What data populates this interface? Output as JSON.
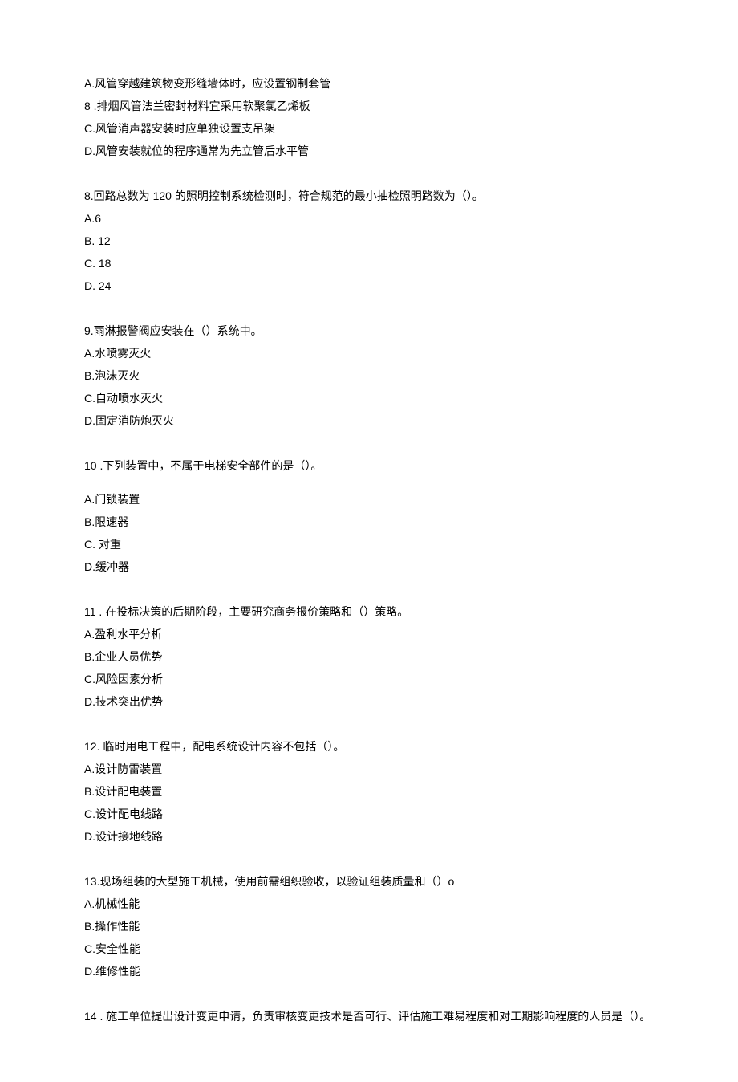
{
  "q7": {
    "optA": "A.风管穿越建筑物变形缝墙体时，应设置钢制套管",
    "optB_prefix": "8",
    "optB_text": " .排烟风管法兰密封材料宜采用软聚氯乙烯板",
    "optC": "C.风管消声器安装时应单独设置支吊架",
    "optD": "D.风管安装就位的程序通常为先立管后水平管"
  },
  "q8": {
    "stem": "8.回路总数为 120 的照明控制系统检测时，符合规范的最小抽检照明路数为（）。",
    "optA": "A.6",
    "optB": "B.   12",
    "optC": "C.   18",
    "optD": "D.   24"
  },
  "q9": {
    "stem": "9.雨淋报警阀应安装在（）系统中。",
    "optA": "A.水喷雾灭火",
    "optB": "B.泡沫灭火",
    "optC": "C.自动喷水灭火",
    "optD": "D.固定消防炮灭火"
  },
  "q10": {
    "stem_prefix": "10",
    "stem_text": "  .下列装置中，不属于电梯安全部件的是（）。",
    "optA": "A.门锁装置",
    "optB": "B.限速器",
    "optC": "C. 对重",
    "optD": "D.缓冲器"
  },
  "q11": {
    "stem_prefix": "11",
    "stem_text": "  . 在投标决策的后期阶段，主要研究商务报价策略和（）策略。",
    "optA": "A.盈利水平分析",
    "optB": "B.企业人员优势",
    "optC": "C.风险因素分析",
    "optD": "D.技术突出优势"
  },
  "q12": {
    "stem": "12. 临时用电工程中，配电系统设计内容不包括（）。",
    "optA": "A.设计防雷装置",
    "optB": "B.设计配电装置",
    "optC": "C.设计配电线路",
    "optD": "D.设计接地线路"
  },
  "q13": {
    "stem": "13.现场组装的大型施工机械，使用前需组织验收，以验证组装质量和（）o",
    "optA": "A.机械性能",
    "optB": "B.操作性能",
    "optC": "C.安全性能",
    "optD": "D.维修性能"
  },
  "q14": {
    "stem_prefix": "14",
    "stem_text": "  . 施工单位提出设计变更申请，负责审核变更技术是否可行、评估施工难易程度和对工期影响程度的人员是（）。"
  }
}
